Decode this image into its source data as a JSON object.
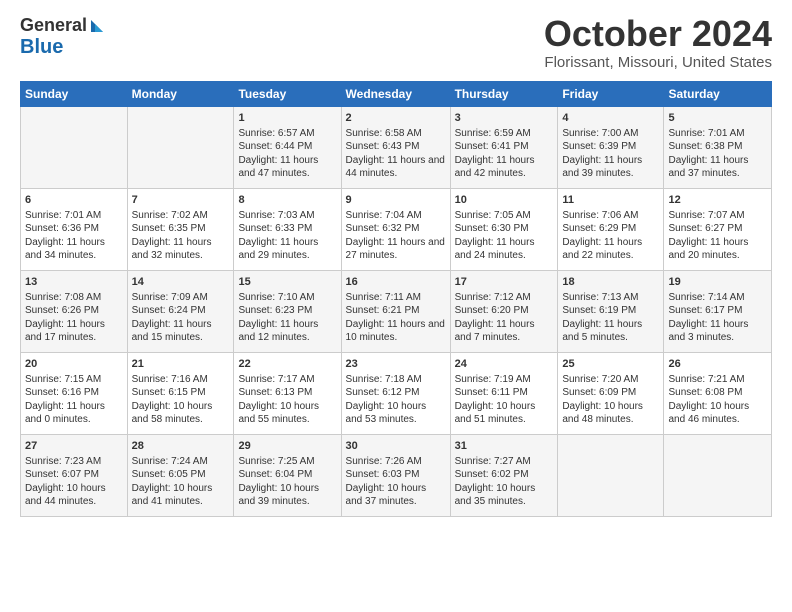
{
  "header": {
    "logo_line1": "General",
    "logo_line2": "Blue",
    "month": "October 2024",
    "location": "Florissant, Missouri, United States"
  },
  "days_of_week": [
    "Sunday",
    "Monday",
    "Tuesday",
    "Wednesday",
    "Thursday",
    "Friday",
    "Saturday"
  ],
  "weeks": [
    [
      {
        "day": "",
        "info": ""
      },
      {
        "day": "",
        "info": ""
      },
      {
        "day": "1",
        "info": "Sunrise: 6:57 AM\nSunset: 6:44 PM\nDaylight: 11 hours and 47 minutes."
      },
      {
        "day": "2",
        "info": "Sunrise: 6:58 AM\nSunset: 6:43 PM\nDaylight: 11 hours and 44 minutes."
      },
      {
        "day": "3",
        "info": "Sunrise: 6:59 AM\nSunset: 6:41 PM\nDaylight: 11 hours and 42 minutes."
      },
      {
        "day": "4",
        "info": "Sunrise: 7:00 AM\nSunset: 6:39 PM\nDaylight: 11 hours and 39 minutes."
      },
      {
        "day": "5",
        "info": "Sunrise: 7:01 AM\nSunset: 6:38 PM\nDaylight: 11 hours and 37 minutes."
      }
    ],
    [
      {
        "day": "6",
        "info": "Sunrise: 7:01 AM\nSunset: 6:36 PM\nDaylight: 11 hours and 34 minutes."
      },
      {
        "day": "7",
        "info": "Sunrise: 7:02 AM\nSunset: 6:35 PM\nDaylight: 11 hours and 32 minutes."
      },
      {
        "day": "8",
        "info": "Sunrise: 7:03 AM\nSunset: 6:33 PM\nDaylight: 11 hours and 29 minutes."
      },
      {
        "day": "9",
        "info": "Sunrise: 7:04 AM\nSunset: 6:32 PM\nDaylight: 11 hours and 27 minutes."
      },
      {
        "day": "10",
        "info": "Sunrise: 7:05 AM\nSunset: 6:30 PM\nDaylight: 11 hours and 24 minutes."
      },
      {
        "day": "11",
        "info": "Sunrise: 7:06 AM\nSunset: 6:29 PM\nDaylight: 11 hours and 22 minutes."
      },
      {
        "day": "12",
        "info": "Sunrise: 7:07 AM\nSunset: 6:27 PM\nDaylight: 11 hours and 20 minutes."
      }
    ],
    [
      {
        "day": "13",
        "info": "Sunrise: 7:08 AM\nSunset: 6:26 PM\nDaylight: 11 hours and 17 minutes."
      },
      {
        "day": "14",
        "info": "Sunrise: 7:09 AM\nSunset: 6:24 PM\nDaylight: 11 hours and 15 minutes."
      },
      {
        "day": "15",
        "info": "Sunrise: 7:10 AM\nSunset: 6:23 PM\nDaylight: 11 hours and 12 minutes."
      },
      {
        "day": "16",
        "info": "Sunrise: 7:11 AM\nSunset: 6:21 PM\nDaylight: 11 hours and 10 minutes."
      },
      {
        "day": "17",
        "info": "Sunrise: 7:12 AM\nSunset: 6:20 PM\nDaylight: 11 hours and 7 minutes."
      },
      {
        "day": "18",
        "info": "Sunrise: 7:13 AM\nSunset: 6:19 PM\nDaylight: 11 hours and 5 minutes."
      },
      {
        "day": "19",
        "info": "Sunrise: 7:14 AM\nSunset: 6:17 PM\nDaylight: 11 hours and 3 minutes."
      }
    ],
    [
      {
        "day": "20",
        "info": "Sunrise: 7:15 AM\nSunset: 6:16 PM\nDaylight: 11 hours and 0 minutes."
      },
      {
        "day": "21",
        "info": "Sunrise: 7:16 AM\nSunset: 6:15 PM\nDaylight: 10 hours and 58 minutes."
      },
      {
        "day": "22",
        "info": "Sunrise: 7:17 AM\nSunset: 6:13 PM\nDaylight: 10 hours and 55 minutes."
      },
      {
        "day": "23",
        "info": "Sunrise: 7:18 AM\nSunset: 6:12 PM\nDaylight: 10 hours and 53 minutes."
      },
      {
        "day": "24",
        "info": "Sunrise: 7:19 AM\nSunset: 6:11 PM\nDaylight: 10 hours and 51 minutes."
      },
      {
        "day": "25",
        "info": "Sunrise: 7:20 AM\nSunset: 6:09 PM\nDaylight: 10 hours and 48 minutes."
      },
      {
        "day": "26",
        "info": "Sunrise: 7:21 AM\nSunset: 6:08 PM\nDaylight: 10 hours and 46 minutes."
      }
    ],
    [
      {
        "day": "27",
        "info": "Sunrise: 7:23 AM\nSunset: 6:07 PM\nDaylight: 10 hours and 44 minutes."
      },
      {
        "day": "28",
        "info": "Sunrise: 7:24 AM\nSunset: 6:05 PM\nDaylight: 10 hours and 41 minutes."
      },
      {
        "day": "29",
        "info": "Sunrise: 7:25 AM\nSunset: 6:04 PM\nDaylight: 10 hours and 39 minutes."
      },
      {
        "day": "30",
        "info": "Sunrise: 7:26 AM\nSunset: 6:03 PM\nDaylight: 10 hours and 37 minutes."
      },
      {
        "day": "31",
        "info": "Sunrise: 7:27 AM\nSunset: 6:02 PM\nDaylight: 10 hours and 35 minutes."
      },
      {
        "day": "",
        "info": ""
      },
      {
        "day": "",
        "info": ""
      }
    ]
  ]
}
